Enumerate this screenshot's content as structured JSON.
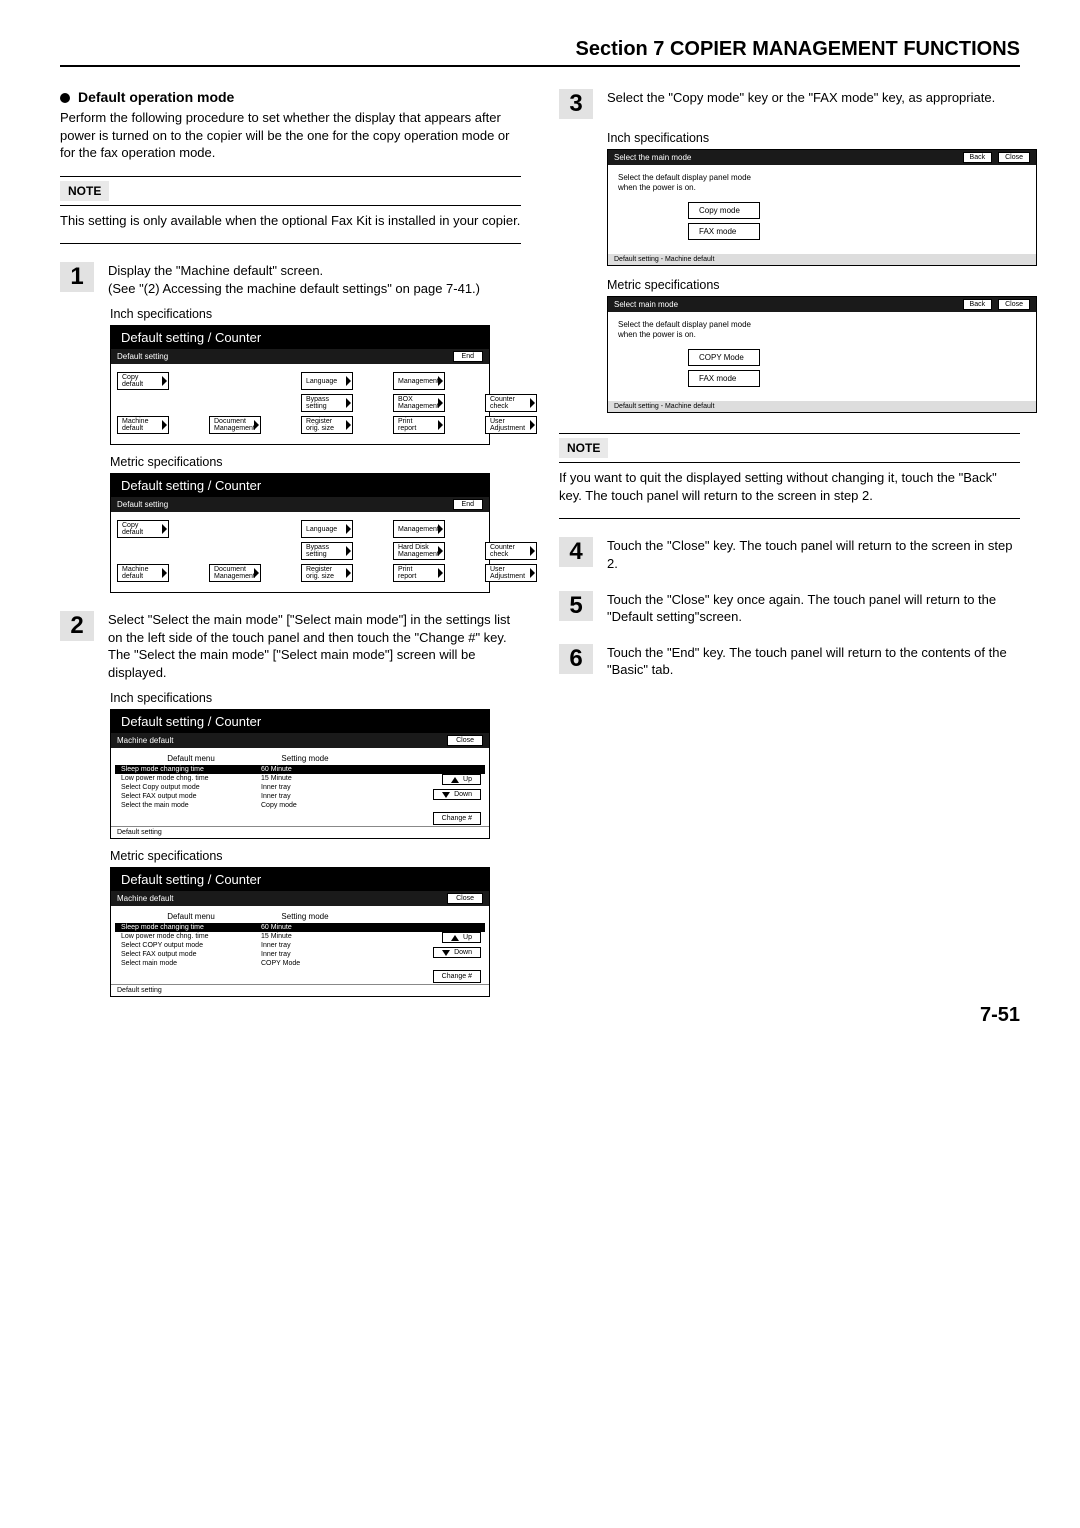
{
  "header": {
    "section": "Section 7  COPIER MANAGEMENT FUNCTIONS"
  },
  "page_number": "7-51",
  "left": {
    "head_bullet": "Default operation mode",
    "intro": "Perform the following procedure to set whether the display that appears after power is turned on to the copier will be the one for the copy operation mode or for the fax operation mode.",
    "note_label": "NOTE",
    "note_text": "This setting is only available when the optional Fax Kit is installed in your copier.",
    "step1_num": "1",
    "step1_text": "Display the \"Machine default\" screen.\n(See \"(2) Accessing the machine default settings\" on page 7-41.)",
    "inch_label": "Inch specifications",
    "metric_label": "Metric specifications",
    "panel_title": "Default setting / Counter",
    "sub_default": "Default setting",
    "end_btn": "End",
    "btns_inch": {
      "copy_default": "Copy\ndefault",
      "machine_default": "Machine\ndefault",
      "document_mgmt": "Document\nManagement",
      "language": "Language",
      "bypass": "Bypass\nsetting",
      "register_orig": "Register\norig. size",
      "management": "Management",
      "box_mgmt": "BOX\nManagement",
      "print_report": "Print\nreport",
      "counter_check": "Counter\ncheck",
      "user_adjust": "User\nAdjustment"
    },
    "btns_metric": {
      "hard_disk": "Hard Disk\nManagement"
    },
    "step2_num": "2",
    "step2_text": "Select \"Select the main mode\" [\"Select main mode\"] in the settings list on the left side of the touch panel and then touch the \"Change #\" key.\nThe \"Select the main mode\" [\"Select main mode\"] screen will be displayed.",
    "machine_default_bar": "Machine default",
    "close_btn": "Close",
    "hdr_menu": "Default menu",
    "hdr_mode": "Setting mode",
    "rows_inch": [
      {
        "c1": "Sleep mode changing time",
        "c2": "60 Minute",
        "sel": true
      },
      {
        "c1": "Low power mode chng. time",
        "c2": "15 Minute"
      },
      {
        "c1": "Select Copy output mode",
        "c2": "Inner tray"
      },
      {
        "c1": "Select FAX output mode",
        "c2": "Inner tray"
      },
      {
        "c1": "Select the main mode",
        "c2": "Copy mode"
      }
    ],
    "rows_metric": [
      {
        "c1": "Sleep mode changing time",
        "c2": "60 Minute",
        "sel": true
      },
      {
        "c1": "Low power mode chng. time",
        "c2": "15 Minute"
      },
      {
        "c1": "Select COPY output mode",
        "c2": "Inner tray"
      },
      {
        "c1": "Select FAX output mode",
        "c2": "Inner tray"
      },
      {
        "c1": "Select main mode",
        "c2": "COPY Mode"
      }
    ],
    "up": "Up",
    "down": "Down",
    "change": "Change #",
    "footer_default": "Default setting"
  },
  "right": {
    "step3_num": "3",
    "step3_text": "Select the \"Copy mode\" key or the \"FAX mode\" key, as appropriate.",
    "inch_label": "Inch specifications",
    "metric_label": "Metric specifications",
    "mm_bar_inch": "Select the main mode",
    "mm_bar_metric": "Select main mode",
    "back": "Back",
    "close": "Close",
    "mm_desc": "Select the default display panel mode\nwhen the power is on.",
    "copy_mode_inch": "Copy mode",
    "copy_mode_metric": "COPY Mode",
    "fax_mode": "FAX mode",
    "mm_footer": "Default setting - Machine default",
    "note_label": "NOTE",
    "note_text": "If you want to quit the displayed setting without changing it, touch the \"Back\" key. The touch panel will return to the screen in step 2.",
    "step4_num": "4",
    "step4_text": "Touch the \"Close\" key. The touch panel will return to the screen in step 2.",
    "step5_num": "5",
    "step5_text": "Touch the \"Close\" key once again. The touch panel will return to the \"Default setting\"screen.",
    "step6_num": "6",
    "step6_text": "Touch the \"End\" key. The touch panel will return to the contents of the \"Basic\" tab."
  }
}
